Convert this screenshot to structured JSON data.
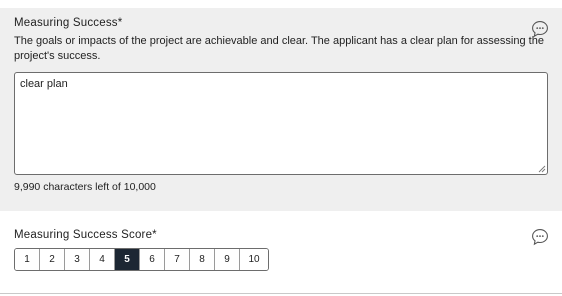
{
  "measuring_success": {
    "title": "Measuring Success*",
    "description": "The goals or impacts of the project are achievable and clear. The applicant has a clear plan for assessing the project's success.",
    "answer_value": "clear plan",
    "char_count": "9,990 characters left of 10,000"
  },
  "score": {
    "title": "Measuring Success Score*",
    "options": [
      "1",
      "2",
      "3",
      "4",
      "5",
      "6",
      "7",
      "8",
      "9",
      "10"
    ],
    "selected": "5"
  },
  "colors": {
    "section_bg": "#efefef",
    "selected_bg": "#1d2733",
    "border": "#6d6d6d"
  },
  "icons": {
    "comment": "comment-bubble-icon"
  }
}
